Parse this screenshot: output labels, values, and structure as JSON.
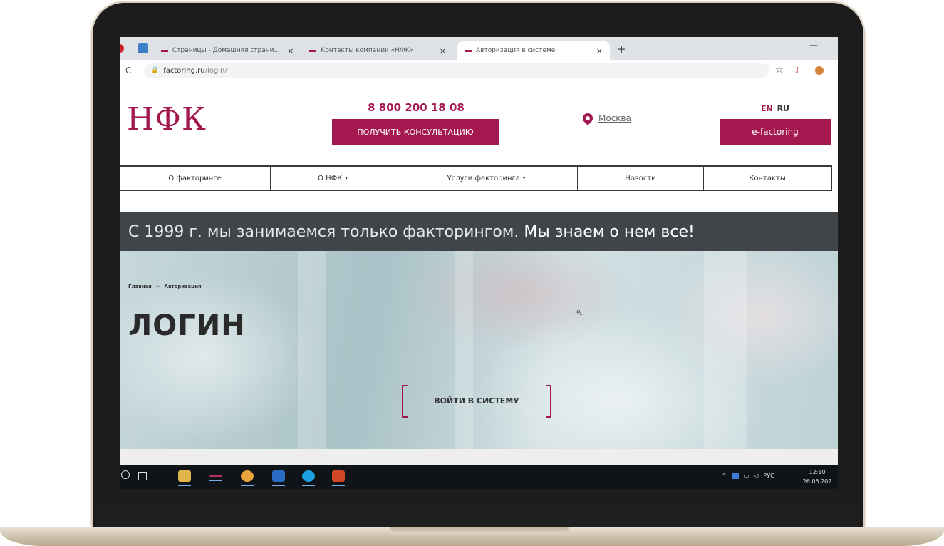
{
  "browser": {
    "tabs": [
      {
        "title": "Страницы - Домашняя страни..."
      },
      {
        "title": "Контакты компании «НФК»"
      },
      {
        "title": "Авторизация в системе"
      }
    ],
    "close_glyph": "×",
    "new_tab_glyph": "+",
    "minimize_glyph": "—",
    "url_host": "factoring.ru",
    "url_path": "/login/",
    "reload_icon": "reload-icon",
    "star_glyph": "☆"
  },
  "header": {
    "logo": "НФК",
    "phone": "8 800 200 18 08",
    "consult_label": "ПОЛУЧИТЬ КОНСУЛЬТАЦИЮ",
    "city": "Москва",
    "lang_en": "EN",
    "lang_ru": "RU",
    "efactoring_label": "e-factoring"
  },
  "nav": {
    "items": [
      {
        "label": "О факторинге"
      },
      {
        "label": "О НФК"
      },
      {
        "label": "Услуги факторинга"
      },
      {
        "label": "Новости"
      },
      {
        "label": "Контакты"
      }
    ],
    "caret": "▾"
  },
  "slogan": {
    "light": "С 1999 г. мы занимаемся только факторингом.",
    "bold": "Мы знаем о нем все!"
  },
  "hero": {
    "breadcrumb_home": "Главная",
    "breadcrumb_sep": ">",
    "breadcrumb_current": "Авторизация",
    "title": "ЛОГИН",
    "login_button": "ВОЙТИ В СИСТЕМУ"
  },
  "taskbar": {
    "tray_lang": "РУС",
    "tray_caret": "^",
    "time": "12:10",
    "date": "26.05.202"
  },
  "colors": {
    "brand": "#a3194f",
    "slogan_band": "#3f4549",
    "taskbar": "#101418"
  }
}
